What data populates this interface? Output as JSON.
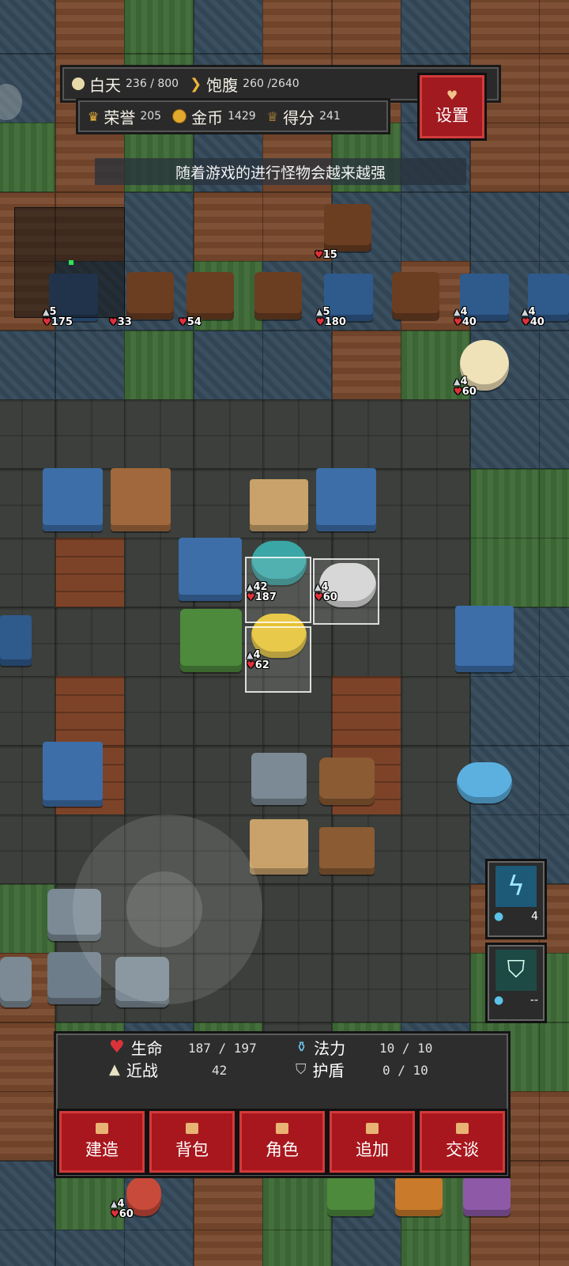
{
  "hud": {
    "day_label": "白天",
    "day_value": "236 / 800",
    "hunger_label": "饱腹",
    "hunger_value": "260 /2640",
    "honor_label": "荣誉",
    "honor_value": "205",
    "gold_label": "金币",
    "gold_value": "1429",
    "score_label": "得分",
    "score_value": "241",
    "settings_label": "设置"
  },
  "tip": "随着游戏的进行怪物会越来越强",
  "enemies": [
    {
      "atk": "5",
      "hp": "175"
    },
    {
      "hp": "33"
    },
    {
      "hp": "54"
    },
    {
      "hp": "15"
    },
    {
      "atk": "5",
      "hp": "180"
    },
    {
      "atk": "4",
      "hp": "40"
    },
    {
      "atk": "4",
      "hp": "40"
    },
    {
      "atk": "4",
      "hp": "60"
    }
  ],
  "party": [
    {
      "atk": "42",
      "hp": "187"
    },
    {
      "atk": "4",
      "hp": "60"
    },
    {
      "atk": "4",
      "hp": "62"
    }
  ],
  "ally_bottom": {
    "atk": "4",
    "hp": "60"
  },
  "skills": [
    {
      "count": "4",
      "icon": "lightning-icon"
    },
    {
      "count": "--",
      "icon": "shield-icon"
    }
  ],
  "panel": {
    "hp_label": "生命",
    "hp_value": "187 / 197",
    "mana_label": "法力",
    "mana_value": "10  /  10",
    "melee_label": "近战",
    "melee_value": "42",
    "shield_label": "护盾",
    "shield_value": "0  /  10"
  },
  "tabs": [
    "建造",
    "背包",
    "角色",
    "追加",
    "交谈"
  ],
  "colors": {
    "accent_red": "#a8171d",
    "hp_red": "#e0313b"
  }
}
